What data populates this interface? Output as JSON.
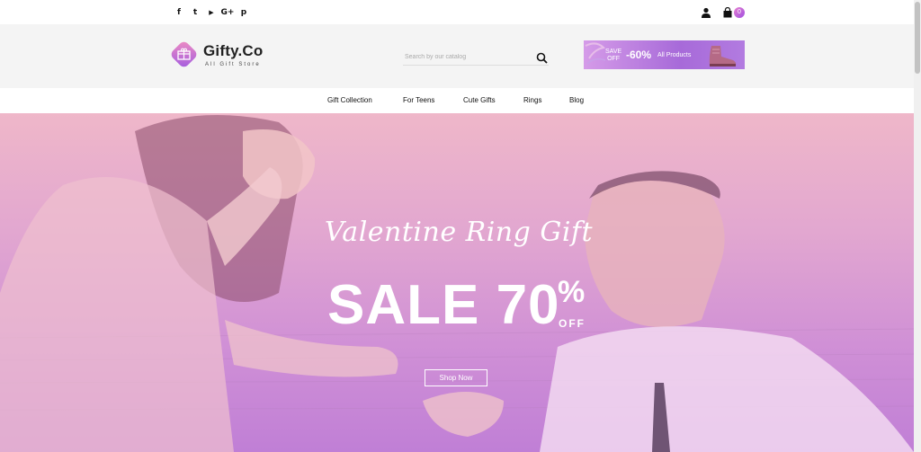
{
  "topbar": {
    "social": [
      {
        "icon": "facebook-icon",
        "glyph": "f"
      },
      {
        "icon": "twitter-icon",
        "glyph": "t"
      },
      {
        "icon": "youtube-icon",
        "glyph": "▶"
      },
      {
        "icon": "google-plus-icon",
        "glyph": "G+"
      },
      {
        "icon": "pinterest-icon",
        "glyph": "p"
      }
    ],
    "cart_count": "0"
  },
  "header": {
    "logo_text": "Gifty.Co",
    "logo_sub": "All Gift Store",
    "search_placeholder": "Search by our catalog",
    "promo": {
      "save_line1": "SAVE",
      "save_line2": "OFF",
      "percent": "-60%",
      "label": "All Products"
    }
  },
  "nav": {
    "items": [
      "Gift Collection",
      "For Teens",
      "Cute Gifts",
      "Rings",
      "Blog"
    ]
  },
  "hero": {
    "title": "Valentine Ring Gift",
    "sale": "SALE 70",
    "percent_symbol": "%",
    "off": "OFF",
    "button": "Shop Now"
  },
  "colors": {
    "accent": "#b46ee0",
    "hero_top": "#efb7c9",
    "hero_bottom": "#c07fd6"
  }
}
